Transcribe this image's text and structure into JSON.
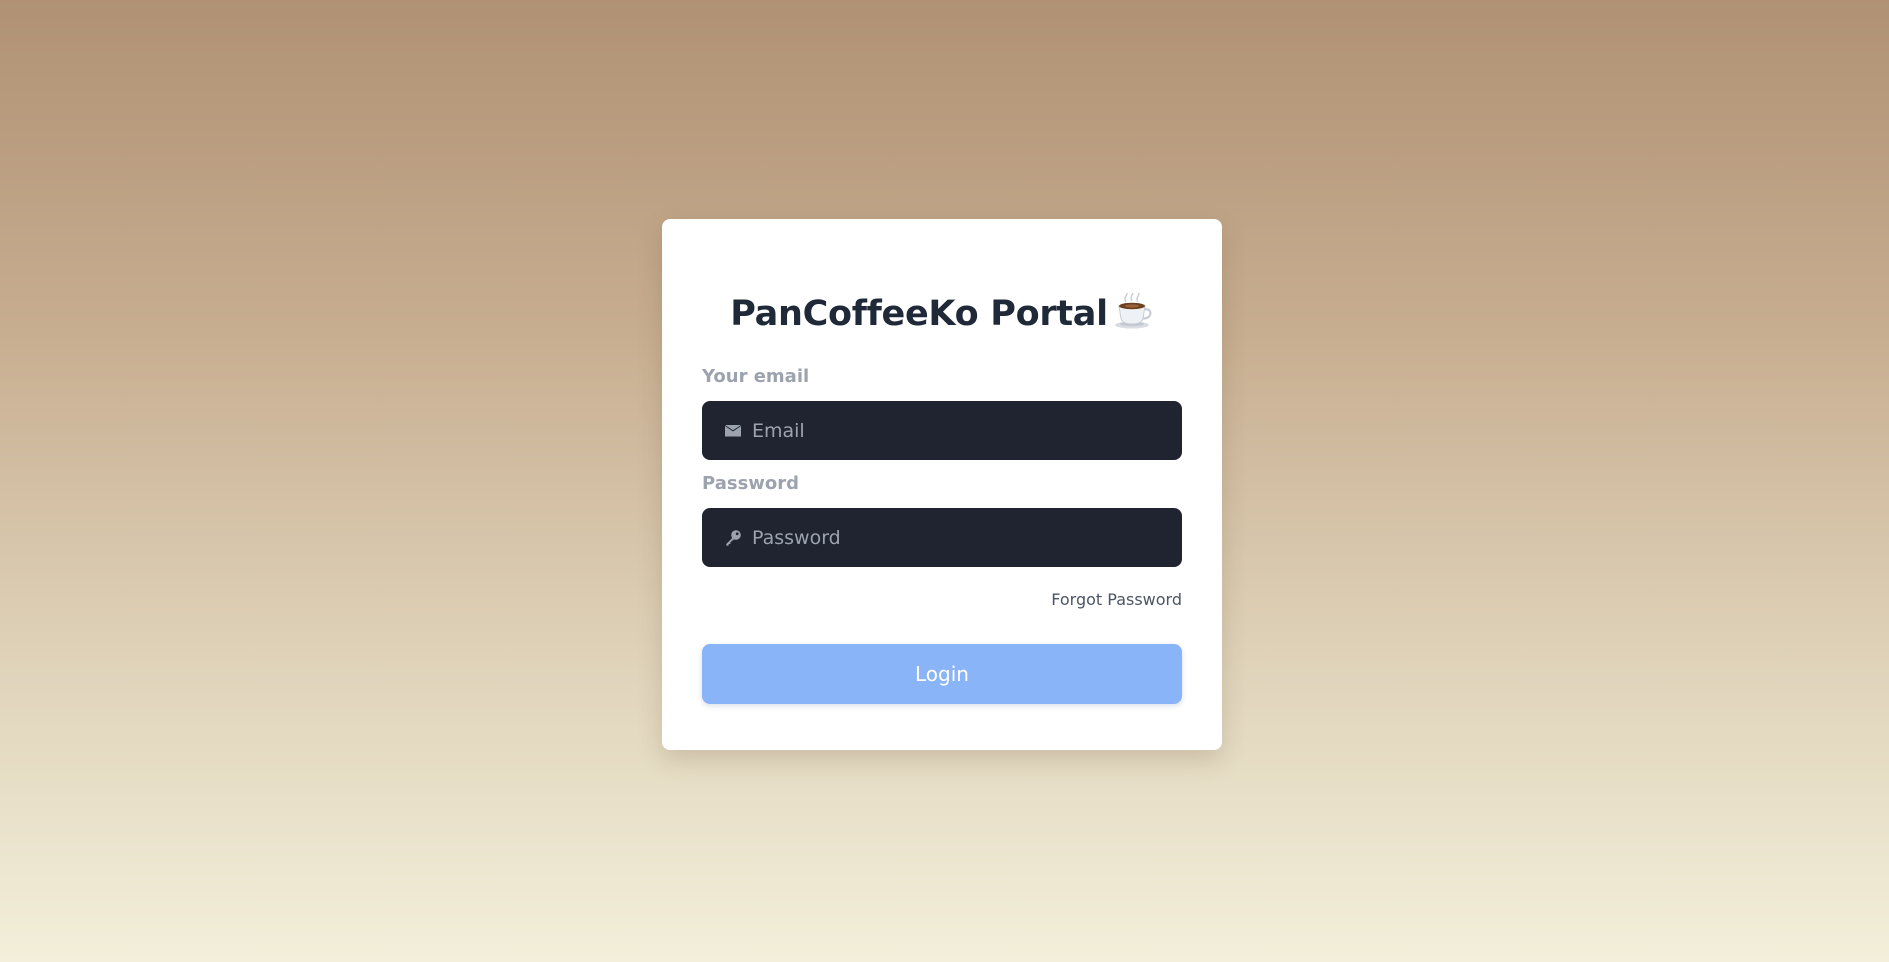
{
  "login": {
    "title": "PanCoffeeKo Portal",
    "title_icon": "coffee-cup-icon",
    "email": {
      "label": "Your email",
      "placeholder": "Email",
      "value": "",
      "icon": "envelope-icon"
    },
    "password": {
      "label": "Password",
      "placeholder": "Password",
      "value": "",
      "icon": "key-icon"
    },
    "forgot_password": "Forgot Password",
    "submit_label": "Login"
  },
  "colors": {
    "background_top": "#b09173",
    "background_bottom": "#f3efda",
    "card": "#ffffff",
    "input_background": "#1f2430",
    "button": "#8ab4f8",
    "title_text": "#1f2937",
    "label_text": "#9ca3af"
  }
}
